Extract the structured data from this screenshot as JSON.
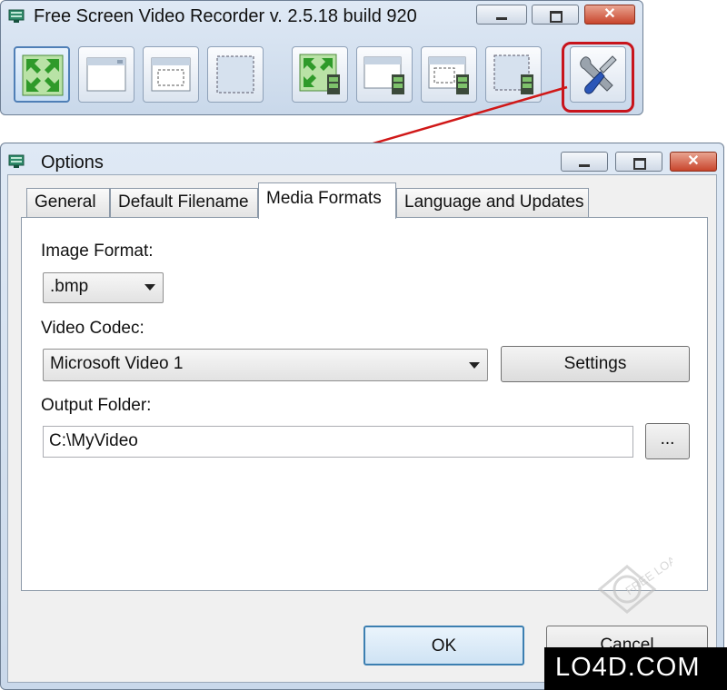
{
  "main_window": {
    "title": "Free Screen Video Recorder  v. 2.5.18 build 920",
    "toolbar": [
      {
        "name": "capture-full-screen-button",
        "icon": "fullscreen-arrows-icon",
        "selected": true
      },
      {
        "name": "capture-window-button",
        "icon": "window-icon",
        "selected": false
      },
      {
        "name": "capture-region-button",
        "icon": "region-window-icon",
        "selected": false
      },
      {
        "name": "capture-object-button",
        "icon": "dashed-rectangle-icon",
        "selected": false
      },
      {
        "name": "record-full-screen-button",
        "icon": "fullscreen-arrows-film-icon",
        "selected": false
      },
      {
        "name": "record-window-button",
        "icon": "window-film-icon",
        "selected": false
      },
      {
        "name": "record-region-button",
        "icon": "region-window-film-icon",
        "selected": false
      },
      {
        "name": "record-object-button",
        "icon": "dashed-rectangle-film-icon",
        "selected": false
      },
      {
        "name": "options-button",
        "icon": "wrench-screwdriver-icon",
        "selected": false
      }
    ]
  },
  "dialog": {
    "title": "Options",
    "tabs": [
      {
        "label": "General",
        "active": false
      },
      {
        "label": "Default Filename",
        "active": false
      },
      {
        "label": "Media Formats",
        "active": true
      },
      {
        "label": "Language and Updates",
        "active": false
      }
    ],
    "image_format": {
      "label": "Image Format:",
      "value": ".bmp"
    },
    "video_codec": {
      "label": "Video Codec:",
      "value": "Microsoft Video 1",
      "settings_label": "Settings"
    },
    "output_folder": {
      "label": "Output Folder:",
      "value": "C:\\MyVideo",
      "browse_label": "..."
    },
    "ok_label": "OK",
    "cancel_label": "Cancel"
  },
  "watermark": {
    "text": "LO4D.COM",
    "logo_text": "FREE LOAD"
  },
  "colors": {
    "highlight_red": "#c8141c",
    "tab_border": "#8c99a8",
    "window_frame": "#c9d8ea"
  }
}
